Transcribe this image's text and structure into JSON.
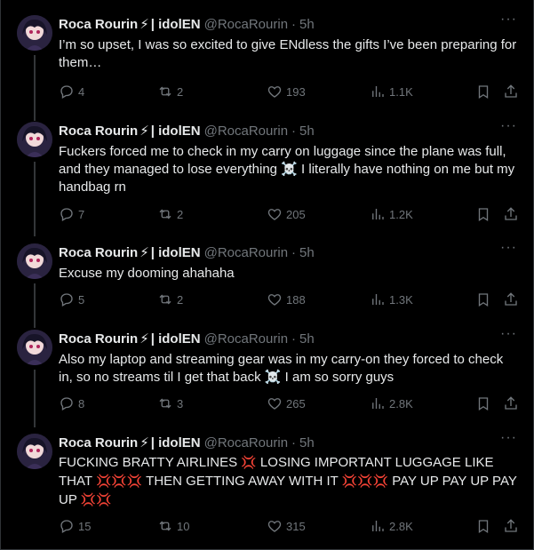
{
  "author": {
    "name": "Roca Rourin",
    "bolt": "⚡",
    "suffix": "| idolEN",
    "handle": "@RocaRourin"
  },
  "tweets": [
    {
      "time": "5h",
      "text": "I’m so upset, I was so excited to give ENdless the gifts I’ve been preparing for them…",
      "replies": "4",
      "reposts": "2",
      "likes": "193",
      "views": "1.1K"
    },
    {
      "time": "5h",
      "text_a": "Fuckers forced me to check in my carry on luggage since the plane was full, and they managed to lose everything",
      "text_b": " I literally have nothing on me but my handbag rn",
      "replies": "7",
      "reposts": "2",
      "likes": "205",
      "views": "1.2K"
    },
    {
      "time": "5h",
      "text": "Excuse my dooming ahahaha",
      "replies": "5",
      "reposts": "2",
      "likes": "188",
      "views": "1.3K"
    },
    {
      "time": "5h",
      "text_a": "Also my laptop and streaming gear was in my carry-on they forced to check in, so no streams til I get that back",
      "text_b": " I am so sorry guys",
      "replies": "8",
      "reposts": "3",
      "likes": "265",
      "views": "2.8K"
    },
    {
      "time": "5h",
      "text_a": "FUCKING BRATTY AIRLINES",
      "text_b": " LOSING IMPORTANT LUGGAGE LIKE THAT",
      "text_c": " THEN GETTING AWAY WITH IT",
      "text_d": " PAY UP PAY UP PAY UP",
      "replies": "15",
      "reposts": "10",
      "likes": "315",
      "views": "2.8K"
    }
  ],
  "emoji": {
    "skull": "☠️",
    "anger": "💢"
  },
  "icons": [
    "reply-icon",
    "repost-icon",
    "like-icon",
    "views-icon",
    "bookmark-icon",
    "share-icon",
    "more-icon"
  ],
  "more_label": "···"
}
